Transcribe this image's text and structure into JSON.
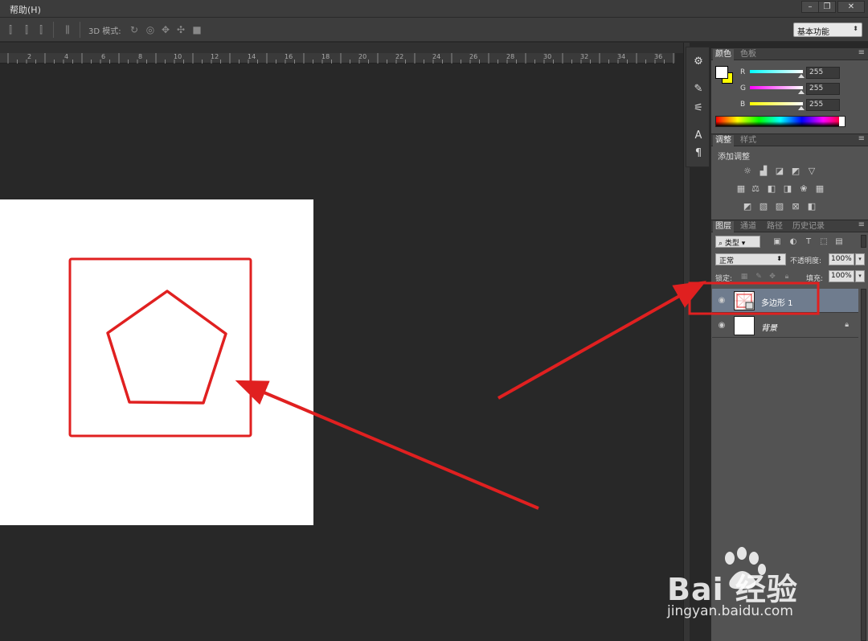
{
  "menu": {
    "help": "帮助(H)"
  },
  "window_controls": [
    "–",
    "❐",
    "✕"
  ],
  "options_bar": {
    "mode_3d_label": "3D 模式:",
    "workspace": "基本功能"
  },
  "ruler": {
    "labels": [
      "2",
      "4",
      "6",
      "8",
      "10",
      "12",
      "14",
      "16",
      "18",
      "20",
      "22",
      "24",
      "26",
      "28",
      "30",
      "32",
      "34",
      "36"
    ]
  },
  "color_panel": {
    "tabs": [
      "颜色",
      "色板"
    ],
    "channels": [
      {
        "name": "R",
        "value": "255"
      },
      {
        "name": "G",
        "value": "255"
      },
      {
        "name": "B",
        "value": "255"
      }
    ],
    "foreground": "#ffffff",
    "background": "#ffff00"
  },
  "adjustments_panel": {
    "tabs": [
      "调整",
      "样式"
    ],
    "title": "添加调整"
  },
  "layers_panel": {
    "tabs": [
      "图层",
      "通道",
      "路径",
      "历史记录"
    ],
    "filter": "类型",
    "blend_mode": "正常",
    "opacity_label": "不透明度:",
    "opacity": "100%",
    "lock_label": "锁定:",
    "fill_label": "填充:",
    "fill": "100%",
    "layers": [
      {
        "name": "多边形 1",
        "selected": true
      },
      {
        "name": "背景",
        "selected": false,
        "locked": true
      }
    ]
  },
  "watermark": {
    "brand": "Bai 经验",
    "url": "jingyan.baidu.com"
  },
  "colors": {
    "annotation_red": "#e02020",
    "selection_blue": "#6f7c8e",
    "canvas_bg": "#282828"
  }
}
